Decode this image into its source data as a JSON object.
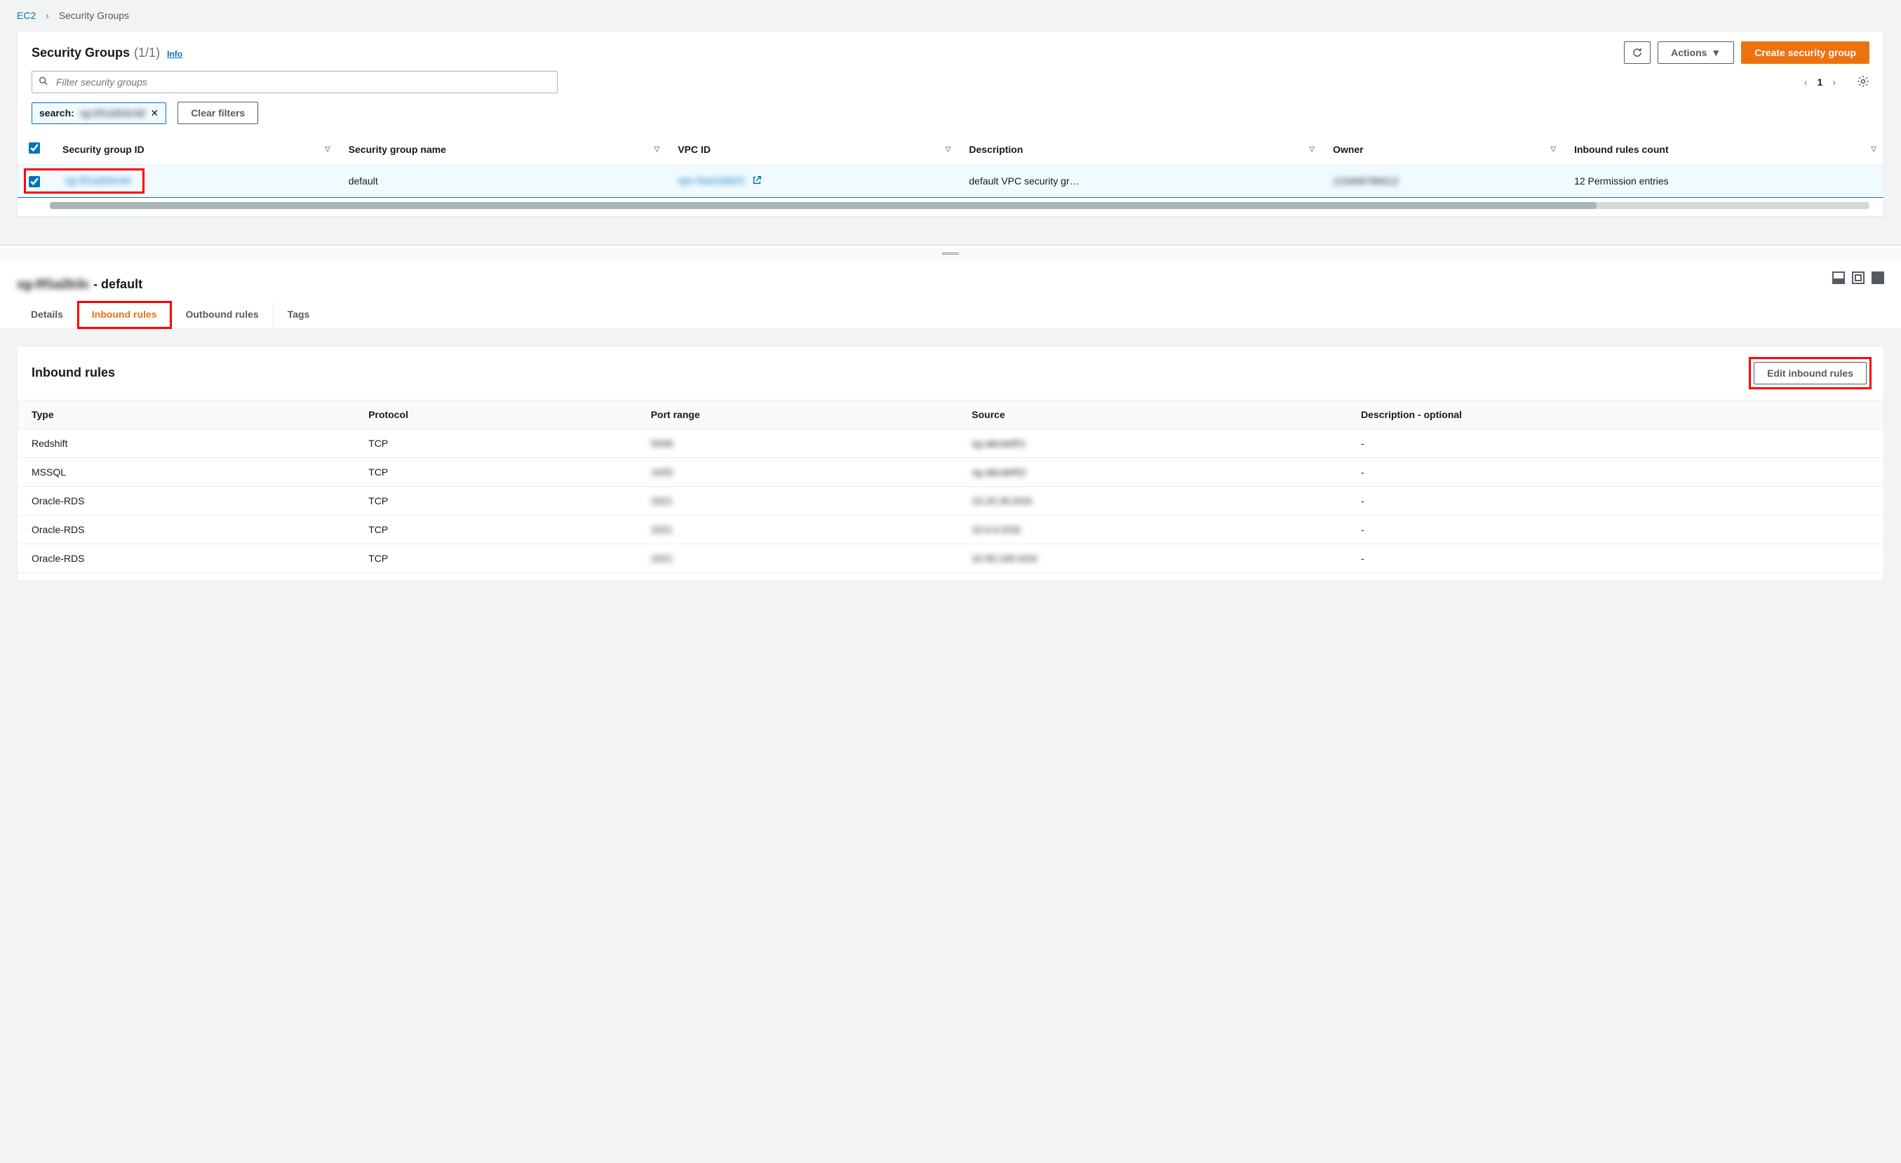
{
  "breadcrumb": {
    "root": "EC2",
    "current": "Security Groups"
  },
  "header": {
    "title": "Security Groups",
    "count": "(1/1)",
    "info": "Info",
    "actions_label": "Actions",
    "create_label": "Create security group"
  },
  "search": {
    "placeholder": "Filter security groups"
  },
  "chip": {
    "label": "search:",
    "value": "sg-0f1a2b3c4d"
  },
  "clear_filters": "Clear filters",
  "pager": {
    "page": "1"
  },
  "columns": {
    "sgid": "Security group ID",
    "sgname": "Security group name",
    "vpcid": "VPC ID",
    "desc": "Description",
    "owner": "Owner",
    "inbound": "Inbound rules count"
  },
  "row": {
    "sgid": "sg-0f1a2b3c4d",
    "sgname": "default",
    "vpcid": "vpc-0aa11bb22",
    "desc": "default VPC security gr…",
    "owner": "123456789012",
    "inbound": "12 Permission entries"
  },
  "detail": {
    "title_id": "sg-0f1a2b3c",
    "title_suffix": " - default",
    "tabs": {
      "details": "Details",
      "inbound": "Inbound rules",
      "outbound": "Outbound rules",
      "tags": "Tags"
    }
  },
  "rules": {
    "heading": "Inbound rules",
    "edit_btn": "Edit inbound rules",
    "cols": {
      "type": "Type",
      "protocol": "Protocol",
      "port": "Port range",
      "source": "Source",
      "desc": "Description - optional"
    },
    "rows": [
      {
        "type": "Redshift",
        "protocol": "TCP",
        "port": "5439",
        "source": "sg-abcdef01",
        "desc": "-"
      },
      {
        "type": "MSSQL",
        "protocol": "TCP",
        "port": "1433",
        "source": "sg-abcdef02",
        "desc": "-"
      },
      {
        "type": "Oracle-RDS",
        "protocol": "TCP",
        "port": "1521",
        "source": "10.20.30.0/24",
        "desc": "-"
      },
      {
        "type": "Oracle-RDS",
        "protocol": "TCP",
        "port": "1521",
        "source": "10.0.0.5/32",
        "desc": "-"
      },
      {
        "type": "Oracle-RDS",
        "protocol": "TCP",
        "port": "1521",
        "source": "10.50.100.0/24",
        "desc": "-"
      }
    ]
  }
}
